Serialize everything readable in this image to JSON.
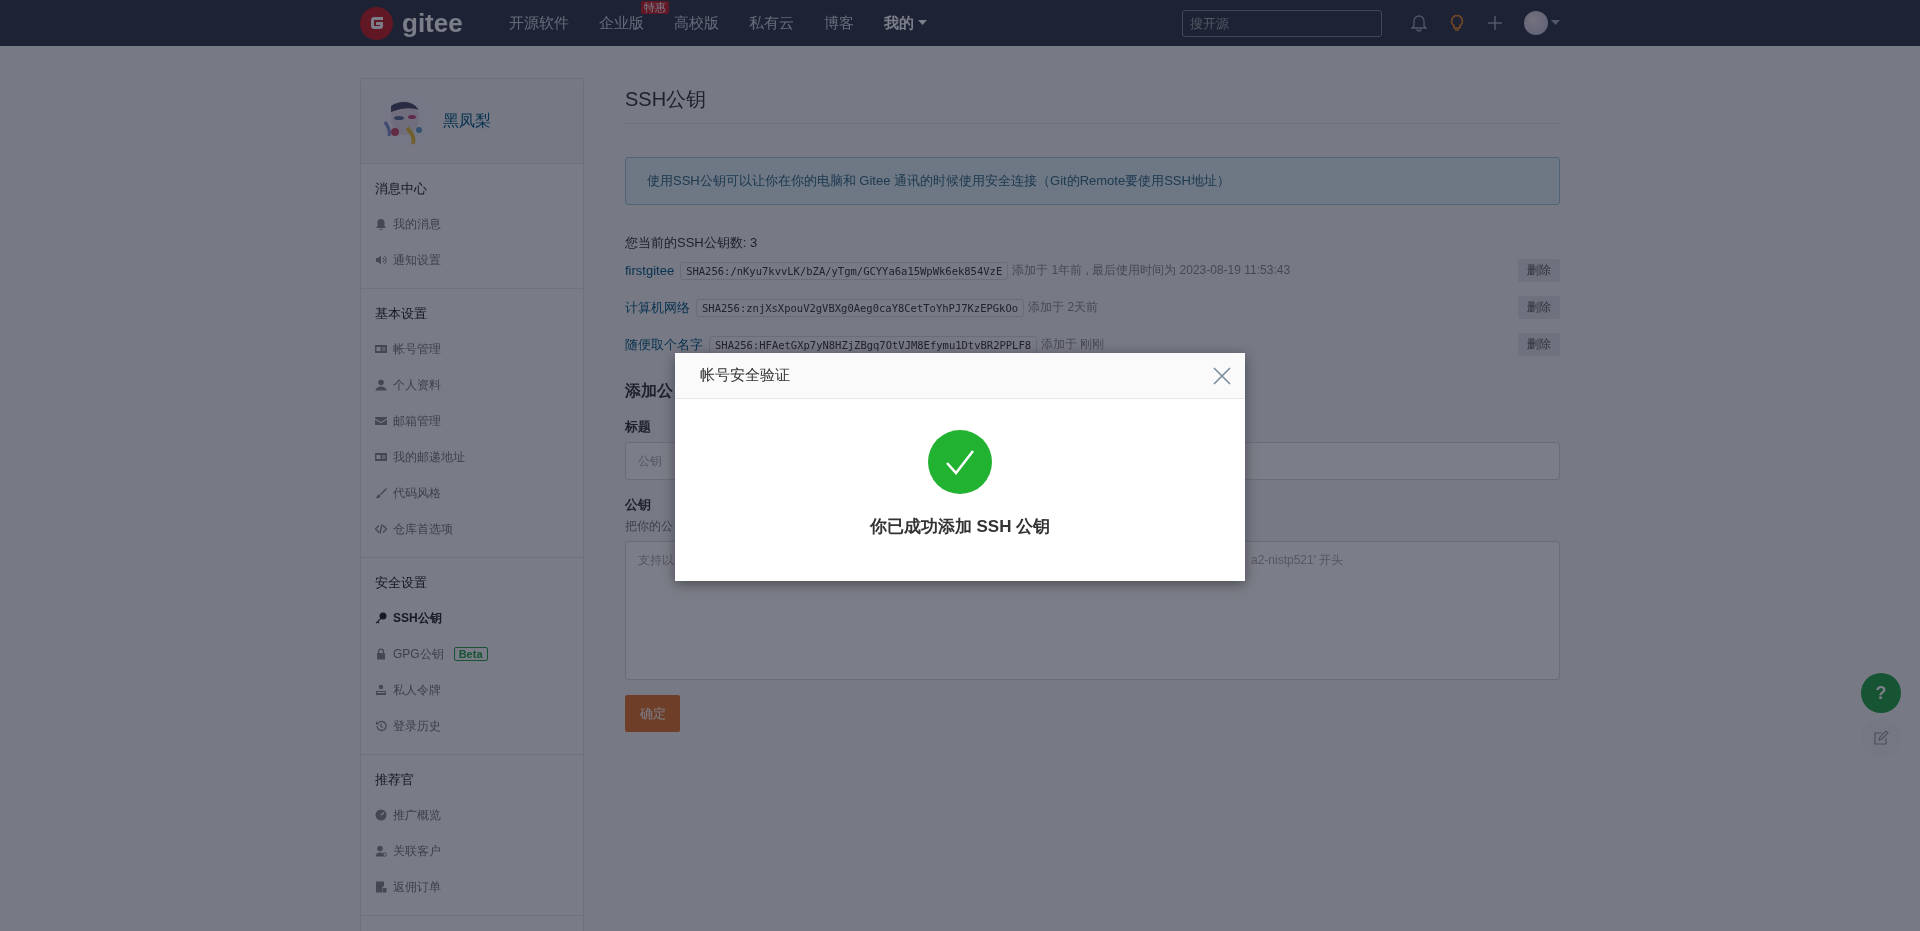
{
  "nav": {
    "logo": "gitee",
    "items": [
      {
        "label": "开源软件",
        "selected": false
      },
      {
        "label": "企业版",
        "selected": false,
        "badge": "特惠"
      },
      {
        "label": "高校版",
        "selected": false
      },
      {
        "label": "私有云",
        "selected": false
      },
      {
        "label": "博客",
        "selected": false
      },
      {
        "label": "我的",
        "selected": true,
        "kind": "menu"
      }
    ],
    "search": {
      "placeholder": "搜开源"
    }
  },
  "sidebar": {
    "user_name": "黑凤梨",
    "sections": [
      {
        "title": "消息中心",
        "items": [
          {
            "label": "我的消息",
            "selected": false
          },
          {
            "label": "通知设置",
            "selected": false
          }
        ]
      },
      {
        "title": "基本设置",
        "items": [
          {
            "label": "帐号管理",
            "selected": false
          },
          {
            "label": "个人资料",
            "selected": false
          },
          {
            "label": "邮箱管理",
            "selected": false
          },
          {
            "label": "我的邮递地址",
            "selected": false
          },
          {
            "label": "代码风格",
            "selected": false
          },
          {
            "label": "仓库首选项",
            "selected": false
          }
        ]
      },
      {
        "title": "安全设置",
        "items": [
          {
            "label": "SSH公钥",
            "selected": true
          },
          {
            "label": "GPG公钥",
            "selected": false,
            "badge": "Beta"
          },
          {
            "label": "私人令牌",
            "selected": false
          },
          {
            "label": "登录历史",
            "selected": false
          }
        ]
      },
      {
        "title": "推荐官",
        "items": [
          {
            "label": "推广概览",
            "selected": false
          },
          {
            "label": "关联客户",
            "selected": false
          },
          {
            "label": "返佣订单",
            "selected": false
          }
        ]
      }
    ]
  },
  "main": {
    "title": "SSH公钥",
    "info": "使用SSH公钥可以让你在你的电脑和 Gitee 通讯的时候使用安全连接（Git的Remote要使用SSH地址）",
    "count": "您当前的SSH公钥数: 3",
    "keys": [
      {
        "name": "firstgitee",
        "fingerprint": "SHA256:/nKyu7kvvLK/bZA/yTgm/GCYYa6a15WpWk6ek854VzE",
        "meta": "添加于 1年前 , 最后使用时间为 2023-08-19 11:53:43",
        "delete": "删除"
      },
      {
        "name": "计算机网络",
        "fingerprint": "SHA256:znjXsXpouV2gVBXg0Aeg0caY8CetToYhPJ7KzEPGkOo",
        "meta": "添加于 2天前",
        "delete": "删除"
      },
      {
        "name": "随便取个名字",
        "fingerprint": "SHA256:HFAetGXp7yN8HZjZBgq7OtVJM8Efymu1DtvBR2PPLF8",
        "meta": "添加于 刚刚",
        "delete": "删除"
      }
    ]
  },
  "form": {
    "heading": "添加公",
    "title_label": "标题",
    "title_placeholder": "公钥",
    "key_label": "公钥",
    "key_hint": "把你的公",
    "key_placeholder_start": "支持以",
    "key_placeholder_end": "a2-nistp521' 开头",
    "submit": "确定"
  },
  "modal": {
    "title": "帐号安全验证",
    "message": "你已成功添加 SSH 公钥"
  },
  "help_button": "?"
}
